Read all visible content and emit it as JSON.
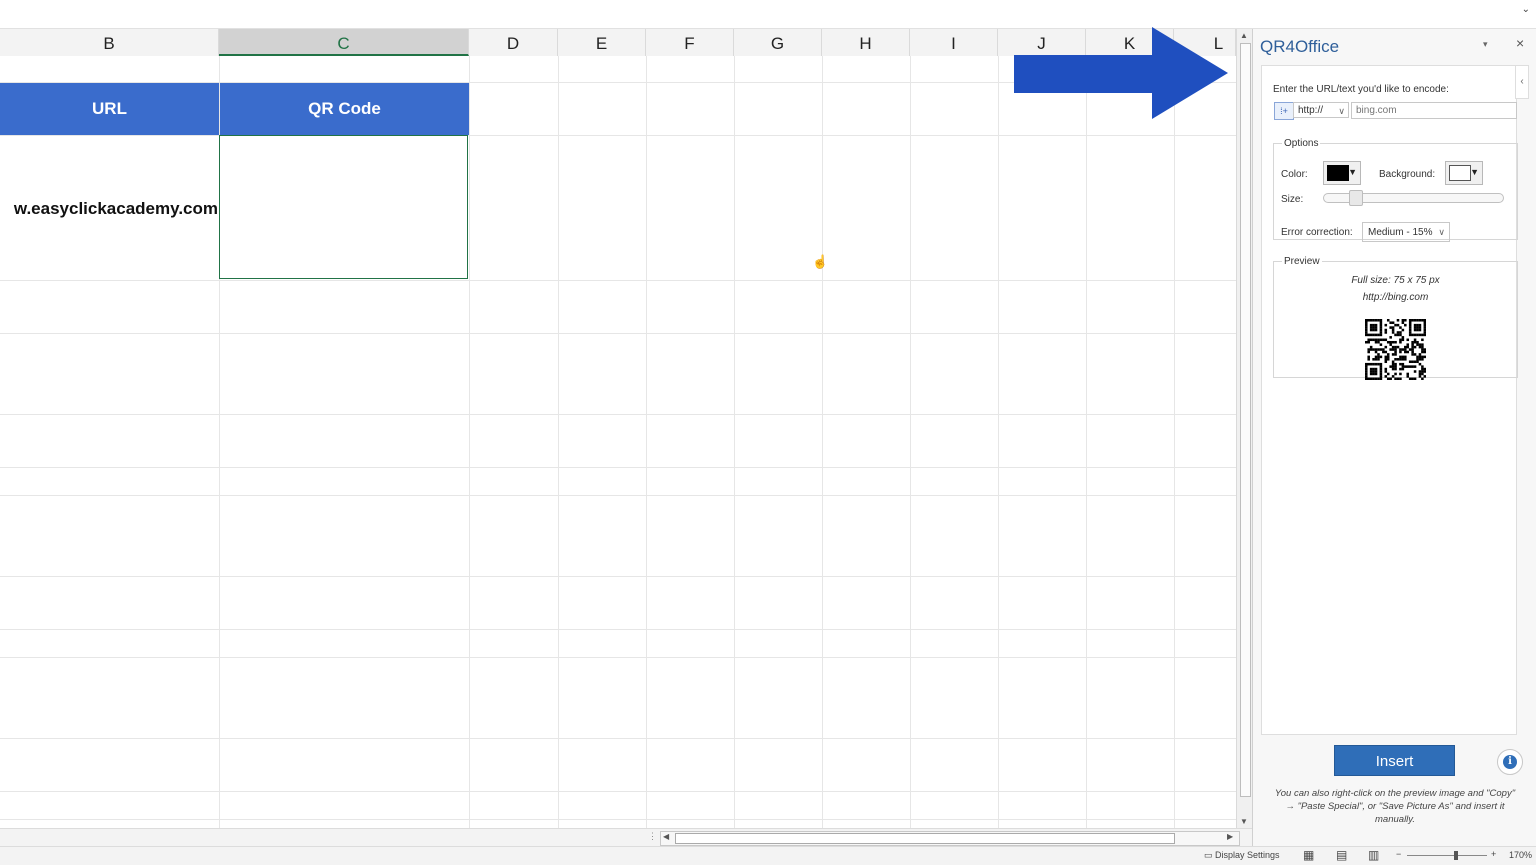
{
  "columns": [
    "B",
    "C",
    "D",
    "E",
    "F",
    "G",
    "H",
    "I",
    "J",
    "K",
    "L"
  ],
  "selected_column": "C",
  "table": {
    "headers": [
      "URL",
      "QR Code"
    ],
    "url_value": "w.easyclickacademy.com"
  },
  "pane": {
    "title": "QR4Office",
    "encode_label": "Enter the URL/text you'd like to encode:",
    "protocol": "http://",
    "url_placeholder": "bing.com",
    "options": {
      "legend": "Options",
      "color_label": "Color:",
      "background_label": "Background:",
      "size_label": "Size:",
      "error_label": "Error correction:",
      "error_value": "Medium - 15%",
      "color_value": "#000000",
      "background_value": "#ffffff",
      "size_fraction": 0.15
    },
    "preview": {
      "legend": "Preview",
      "full_size": "Full size: 75 x 75 px",
      "url": "http://bing.com"
    },
    "insert_label": "Insert",
    "hint": "You can also right-click on the preview image and \"Copy\" → \"Paste Special\", or \"Save Picture As\" and insert it manually."
  },
  "status": {
    "display_settings": "Display Settings",
    "zoom": "170%"
  },
  "colors": {
    "header_fill": "#3a6ccc",
    "accent_green": "#217346",
    "arrow": "#1f4fbf",
    "insert_button": "#2f6eb8"
  }
}
